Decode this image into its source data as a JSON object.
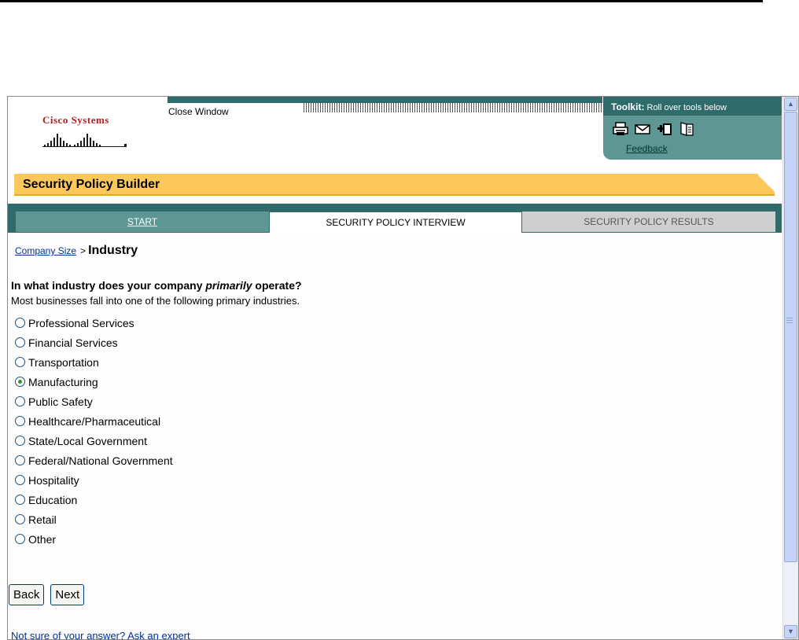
{
  "header": {
    "logo_text": "Cisco Systems",
    "close_window": "Close Window",
    "toolkit": {
      "title": "Toolkit:",
      "subtitle": "Roll over tools below",
      "icons": [
        "print-icon",
        "email-icon",
        "add-icon",
        "document-icon"
      ],
      "feedback": "Feedback"
    }
  },
  "page": {
    "title": "Security Policy Builder"
  },
  "tabs": [
    {
      "label": "START",
      "state": "link"
    },
    {
      "label": "SECURITY POLICY INTERVIEW",
      "state": "active"
    },
    {
      "label": "SECURITY POLICY RESULTS",
      "state": "disabled"
    }
  ],
  "breadcrumb": {
    "link": "Company Size",
    "separator": ">",
    "current": "Industry"
  },
  "question": {
    "text_before": "In what industry does your company ",
    "emphasis": "primarily",
    "text_after": " operate?",
    "helper": "Most businesses fall into one of the following primary industries."
  },
  "options": [
    {
      "label": "Professional Services",
      "selected": false
    },
    {
      "label": "Financial Services",
      "selected": false
    },
    {
      "label": "Transportation",
      "selected": false
    },
    {
      "label": "Manufacturing",
      "selected": true
    },
    {
      "label": "Public Safety",
      "selected": false
    },
    {
      "label": "Healthcare/Pharmaceutical",
      "selected": false
    },
    {
      "label": "State/Local Government",
      "selected": false
    },
    {
      "label": "Federal/National Government",
      "selected": false
    },
    {
      "label": "Hospitality",
      "selected": false
    },
    {
      "label": "Education",
      "selected": false
    },
    {
      "label": "Retail",
      "selected": false
    },
    {
      "label": "Other",
      "selected": false
    }
  ],
  "buttons": {
    "back": "Back",
    "next": "Next"
  },
  "footer": {
    "expert_link": "Not sure of your answer? Ask an expert"
  },
  "colors": {
    "teal_dark": "#2f6b6b",
    "teal": "#5e9693",
    "title_bar": "#fcc85b",
    "link": "#003399",
    "logo_red": "#b41e1e"
  }
}
